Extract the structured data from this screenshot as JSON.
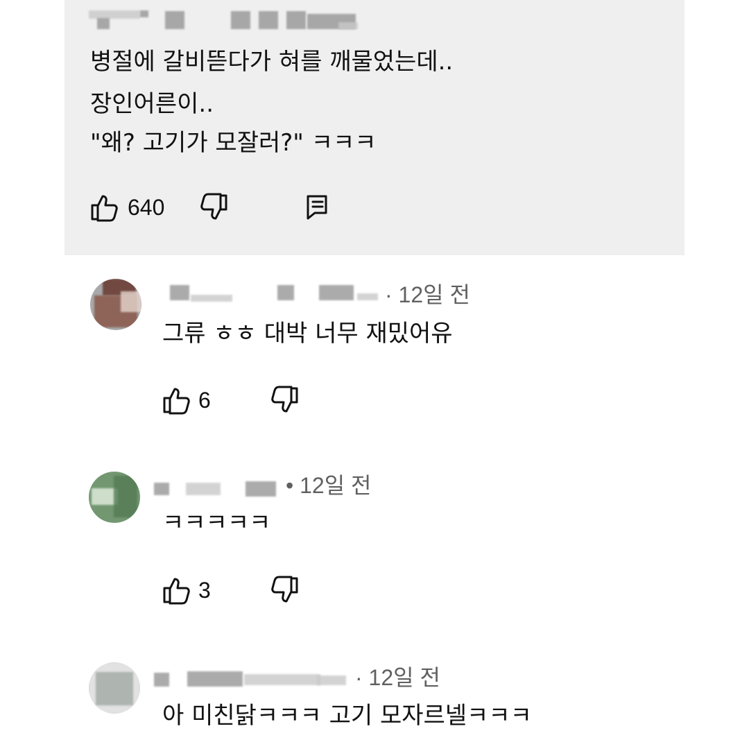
{
  "main_comment": {
    "lines": [
      "병절에 갈비뜯다가 혀를 깨물었는데..",
      "장인어른이..",
      "\"왜? 고기가 모잘러?\" ㅋㅋㅋ"
    ],
    "likes": "640"
  },
  "replies": [
    {
      "time": "· 12일 전",
      "text": "그류  ㅎㅎ 대박 너무 재밌어유",
      "likes": "6"
    },
    {
      "time": "• 12일 전",
      "text": "ㅋㅋㅋㅋㅋ",
      "likes": "3"
    },
    {
      "time": "· 12일 전",
      "text": "아 미친닭ㅋㅋㅋ 고기 모자르넬ㅋㅋㅋ"
    }
  ],
  "icons": {
    "like": "thumbs-up-icon",
    "dislike": "thumbs-down-icon",
    "reply": "reply-icon"
  }
}
